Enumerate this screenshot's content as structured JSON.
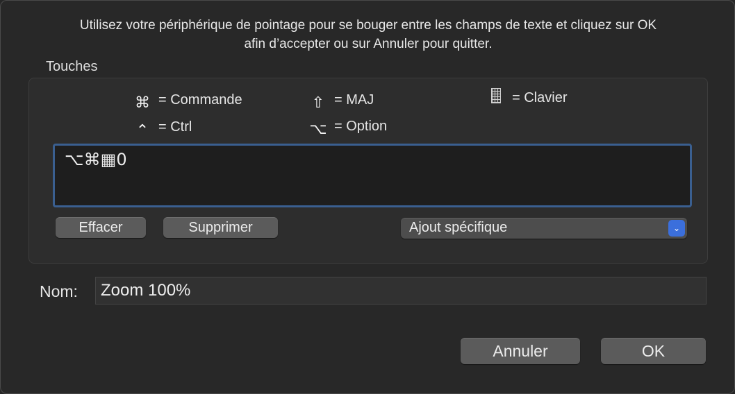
{
  "instructions": {
    "line1": "Utilisez votre périphérique de pointage pour se bouger entre les champs de texte et cliquez sur OK",
    "line2": "afin d’accepter ou sur Annuler pour quitter."
  },
  "keys_group": {
    "label": "Touches",
    "legend": {
      "command": {
        "symbol": "⌘",
        "text": "= Commande"
      },
      "control": {
        "symbol": "⌃",
        "text": "= Ctrl"
      },
      "shift": {
        "symbol": "⇧",
        "text": "= MAJ"
      },
      "option": {
        "symbol": "⌥",
        "text": "= Option"
      },
      "keypad": {
        "icon": "keypad-icon",
        "text": "= Clavier"
      }
    },
    "shortcut_value": "⌥⌘▦0",
    "clear_label": "Effacer",
    "delete_label": "Supprimer",
    "special_add": {
      "selected": "Ajout spécifique"
    }
  },
  "name_field": {
    "label": "Nom:",
    "value": "Zoom 100%"
  },
  "buttons": {
    "cancel": "Annuler",
    "ok": "OK"
  },
  "colors": {
    "background": "#282828",
    "focus_ring": "#3a5f90",
    "popup_accent": "#3b6fdc",
    "button": "#5b5b5b"
  }
}
